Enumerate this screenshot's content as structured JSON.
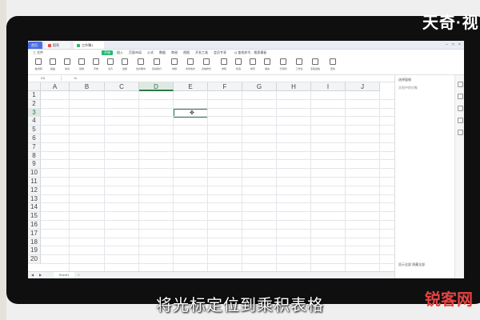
{
  "brand_logo_text": "天奇·视",
  "subtitle": "将光标定位到乘积表格",
  "watermark": "锐客网",
  "titlebar": {
    "tabs": [
      {
        "label": "首页",
        "icon": "home-icon"
      },
      {
        "label": "稻壳",
        "icon": "docer-icon"
      },
      {
        "label": "工作簿1",
        "icon": "sheet-icon"
      }
    ]
  },
  "menu": [
    "三 文件",
    "开始",
    "插入",
    "页面布局",
    "公式",
    "数据",
    "审阅",
    "视图",
    "开发工具",
    "会员专享",
    "Q 查找命令、搜索模板"
  ],
  "ribbon_buttons": [
    "格式刷",
    "粘贴",
    "剪切",
    "复制",
    "字体",
    "对齐",
    "边框",
    "合并居中",
    "自动换行",
    "常规",
    "条件格式",
    "表格样式",
    "求和",
    "筛选",
    "排序",
    "填充",
    "行和列",
    "工作表",
    "冻结窗格",
    "查找"
  ],
  "formula_bar": {
    "cell_ref": "D3",
    "fx": "fx"
  },
  "grid": {
    "columns": [
      "A",
      "B",
      "C",
      "D",
      "E",
      "F",
      "G",
      "H",
      "I",
      "J"
    ],
    "rows": [
      "1",
      "2",
      "3",
      "4",
      "5",
      "6",
      "7",
      "8",
      "9",
      "10",
      "11",
      "12",
      "13",
      "14",
      "15",
      "16",
      "17",
      "18",
      "19",
      "20"
    ],
    "selected_column": "D",
    "selected_row": "3",
    "cursor_glyph": "✥"
  },
  "sheet_tabs": {
    "active": "Sheet1",
    "add": "+"
  },
  "right_panel": {
    "title": "选择窗格",
    "subtitle": "文档中的对象",
    "bottom": "显示全部 隐藏全部"
  },
  "colors": {
    "accent": "#2c7a48",
    "wps_blue": "#4a6fe3",
    "watermark_red": "#e8423f"
  }
}
